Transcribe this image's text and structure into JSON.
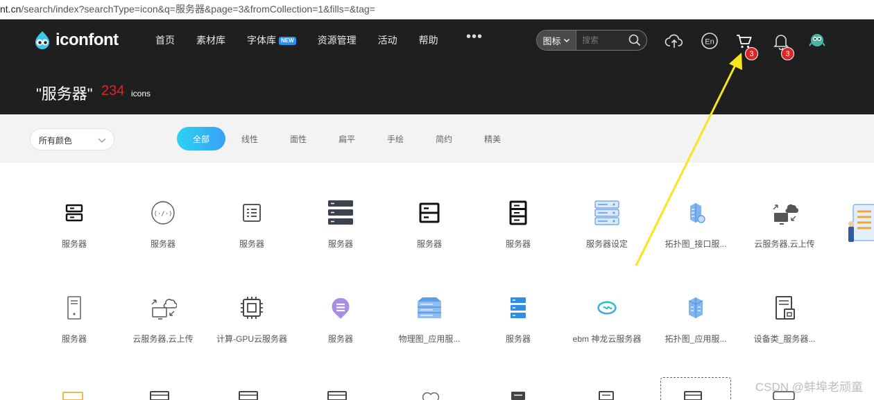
{
  "browser": {
    "url_host": "nt.cn",
    "url_path": "/search/index?searchType=icon&q=服务器&page=3&fromCollection=1&fills=&tag="
  },
  "brand": {
    "name": "iconfont",
    "color": "#1f1f1f",
    "accent": "#3aa0f6"
  },
  "nav": {
    "items": [
      "首页",
      "素材库",
      "字体库",
      "资源管理",
      "活动",
      "帮助"
    ],
    "new_badge": "NEW",
    "more": "•••",
    "search": {
      "type_label": "图标",
      "placeholder": "搜索"
    },
    "cart_count": "3",
    "notification_count": "3",
    "icons": [
      "upload-cloud-icon",
      "language-en-icon",
      "cart-icon",
      "bell-icon",
      "avatar-icon"
    ]
  },
  "heading": {
    "query": "\"服务器\"",
    "count": "234",
    "unit": "icons"
  },
  "filters": {
    "color_select": "所有颜色",
    "tabs": [
      "全部",
      "线性",
      "面性",
      "扁平",
      "手绘",
      "简约",
      "精美"
    ],
    "active_tab": "全部"
  },
  "grid": {
    "row1": [
      "服务器",
      "服务器",
      "服务器",
      "服务器",
      "服务器",
      "服务器",
      "服务器设定",
      "拓扑图_接口服...",
      "云服务器,云上传"
    ],
    "row2": [
      "服务器",
      "云服务器,云上传",
      "计算-GPU云服务器",
      "服务器",
      "物理图_应用服...",
      "服务器",
      "ebm 神龙云服务器",
      "拓扑图_应用服...",
      "设备类_服务器..."
    ]
  },
  "annotation": {
    "arrow_color": "#f5e71a"
  },
  "watermark": "CSDN @蚌埠老顽童"
}
